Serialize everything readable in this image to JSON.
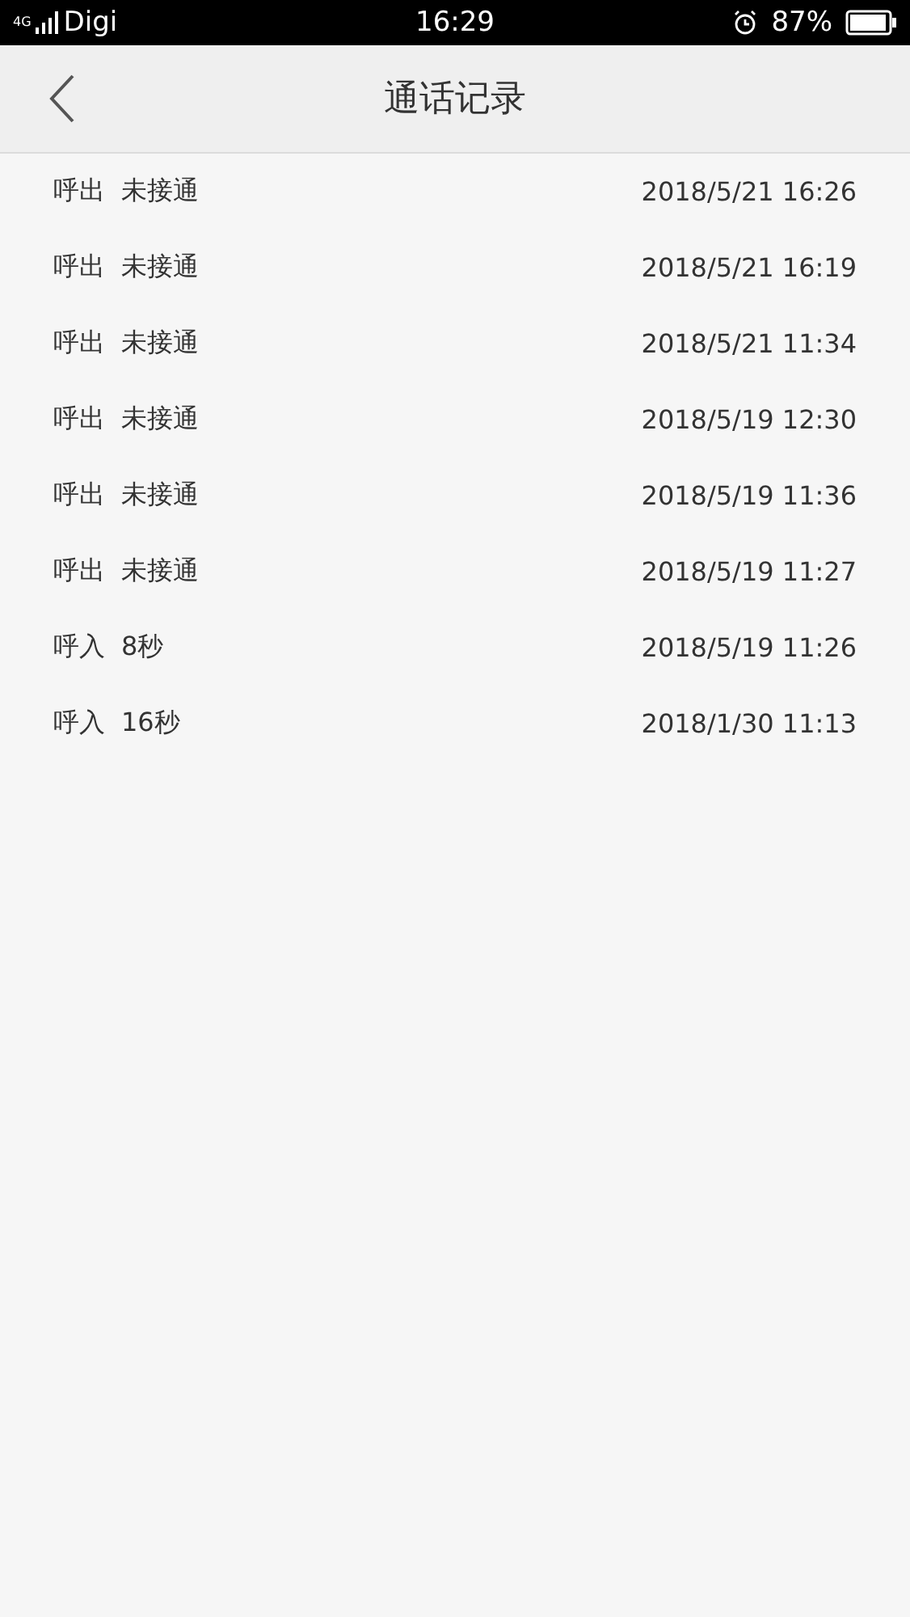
{
  "status_bar": {
    "network": "4G",
    "carrier": "Digi",
    "time": "16:29",
    "battery": "87%"
  },
  "header": {
    "title": "通话记录"
  },
  "calls": [
    {
      "direction": "呼出",
      "result": "未接通",
      "datetime": "2018/5/21 16:26"
    },
    {
      "direction": "呼出",
      "result": "未接通",
      "datetime": "2018/5/21 16:19"
    },
    {
      "direction": "呼出",
      "result": "未接通",
      "datetime": "2018/5/21 11:34"
    },
    {
      "direction": "呼出",
      "result": "未接通",
      "datetime": "2018/5/19 12:30"
    },
    {
      "direction": "呼出",
      "result": "未接通",
      "datetime": "2018/5/19 11:36"
    },
    {
      "direction": "呼出",
      "result": "未接通",
      "datetime": "2018/5/19 11:27"
    },
    {
      "direction": "呼入",
      "result": "8秒",
      "datetime": "2018/5/19 11:26"
    },
    {
      "direction": "呼入",
      "result": "16秒",
      "datetime": "2018/1/30 11:13"
    }
  ]
}
